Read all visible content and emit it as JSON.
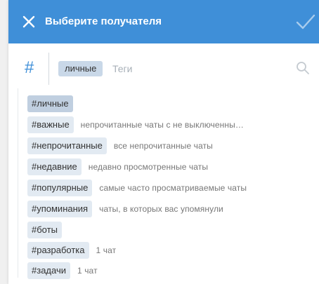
{
  "colors": {
    "header_bg": "#3f8fd8",
    "chip_bg": "#e2eaf2",
    "chip_active_bg": "#c0cfe0",
    "accent": "#3f8fd8"
  },
  "header": {
    "title": "Выберите получателя",
    "close_icon": "close-icon",
    "confirm_icon": "checkmark-icon"
  },
  "search": {
    "hash_symbol": "#",
    "selected_tag": "личные",
    "placeholder": "Теги",
    "value": "",
    "search_icon": "search-icon"
  },
  "suggestions": [
    {
      "tag": "#личные",
      "desc": "",
      "active": true
    },
    {
      "tag": "#важные",
      "desc": "непрочитанные чаты с не выключенны…"
    },
    {
      "tag": "#непрочитанные",
      "desc": "все непрочитанные чаты"
    },
    {
      "tag": "#недавние",
      "desc": "недавно просмотренные чаты"
    },
    {
      "tag": "#популярные",
      "desc": "самые часто просматриваемые чаты"
    },
    {
      "tag": "#упоминания",
      "desc": "чаты, в которых вас упомянули"
    },
    {
      "tag": "#боты",
      "desc": ""
    },
    {
      "tag": "#разработка",
      "desc": "1 чат"
    },
    {
      "tag": "#задачи",
      "desc": "1 чат"
    }
  ]
}
